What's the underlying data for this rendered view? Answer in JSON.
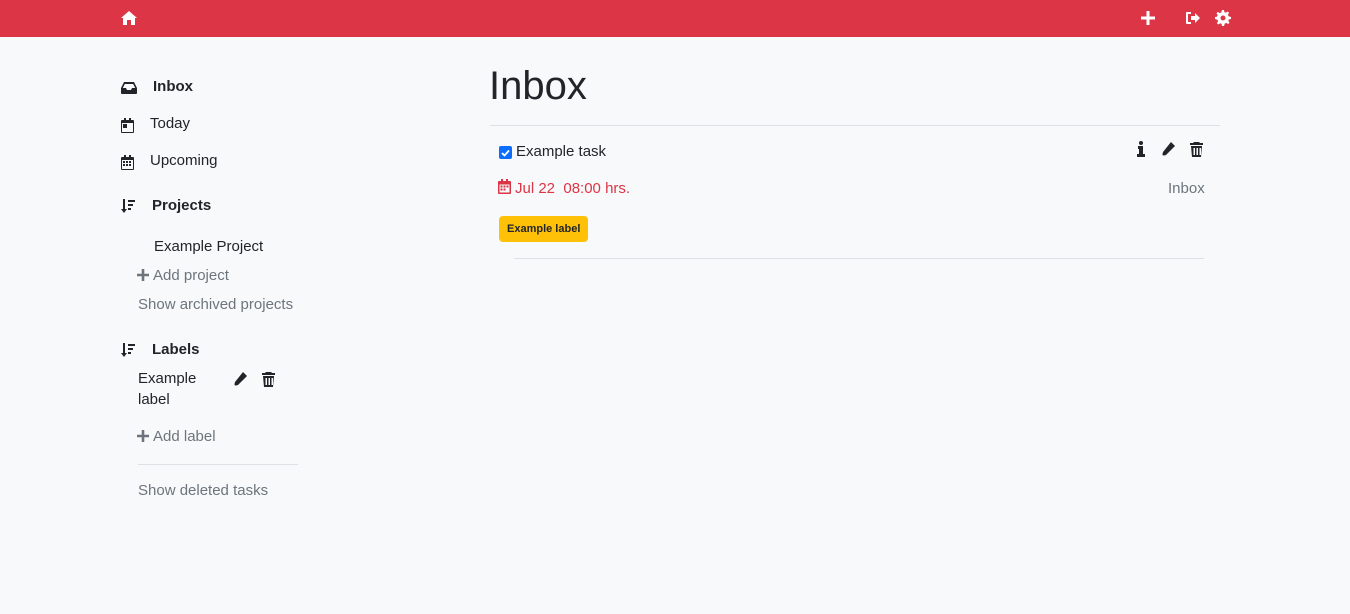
{
  "topbar": {
    "color": "#dc3545",
    "icons": [
      "home-icon",
      "plus-icon",
      "sign-out-icon",
      "gear-icon"
    ]
  },
  "sidebar": {
    "inbox": "Inbox",
    "today": "Today",
    "upcoming": "Upcoming",
    "projects_heading": "Projects",
    "projects": [
      "Example Project"
    ],
    "add_project": "Add project",
    "show_archived": "Show archived projects",
    "labels_heading": "Labels",
    "labels": [
      "Example",
      "label"
    ],
    "add_label": "Add label",
    "show_deleted": "Show deleted tasks"
  },
  "main": {
    "title": "Inbox",
    "tasks": [
      {
        "title": "Example task",
        "done": true,
        "date": "Jul 22  08:00 hrs.",
        "project": "Inbox",
        "label": "Example label"
      }
    ]
  }
}
